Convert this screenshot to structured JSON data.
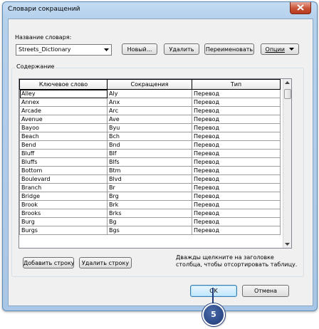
{
  "window": {
    "title": "Словари сокращений"
  },
  "dictionary": {
    "label": "Название словаря:",
    "value": "Streets_Dictionary"
  },
  "toolbar": {
    "new_label": "Новый...",
    "delete_label": "Удалить",
    "rename_label": "Переименовать",
    "options_label": "Опции"
  },
  "content": {
    "group_label": "Содержание"
  },
  "table": {
    "headers": [
      "Ключевое слово",
      "Сокращения",
      "Тип"
    ],
    "rows": [
      [
        "Alley",
        "Aly",
        "Перевод"
      ],
      [
        "Annex",
        "Anx",
        "Перевод"
      ],
      [
        "Arcade",
        "Arc",
        "Перевод"
      ],
      [
        "Avenue",
        "Ave",
        "Перевод"
      ],
      [
        "Bayoo",
        "Byu",
        "Перевод"
      ],
      [
        "Beach",
        "Bch",
        "Перевод"
      ],
      [
        "Bend",
        "Bnd",
        "Перевод"
      ],
      [
        "Bluff",
        "Blf",
        "Перевод"
      ],
      [
        "Bluffs",
        "Blfs",
        "Перевод"
      ],
      [
        "Bottom",
        "Btm",
        "Перевод"
      ],
      [
        "Boulevard",
        "Blvd",
        "Перевод"
      ],
      [
        "Branch",
        "Br",
        "Перевод"
      ],
      [
        "Bridge",
        "Brg",
        "Перевод"
      ],
      [
        "Brook",
        "Brk",
        "Перевод"
      ],
      [
        "Brooks",
        "Brks",
        "Перевод"
      ],
      [
        "Burg",
        "Bg",
        "Перевод"
      ],
      [
        "Burgs",
        "Bgs",
        "Перевод"
      ]
    ]
  },
  "actions": {
    "add_row": "Добавить строку",
    "delete_row": "Удалить строку"
  },
  "hint": "Дважды щелкните на заголовке столбца, чтобы отсортировать таблицу.",
  "footer": {
    "ok_label": "OK",
    "cancel_label": "Отмена"
  },
  "callout": {
    "number": "5",
    "color": "#1f3a78"
  }
}
